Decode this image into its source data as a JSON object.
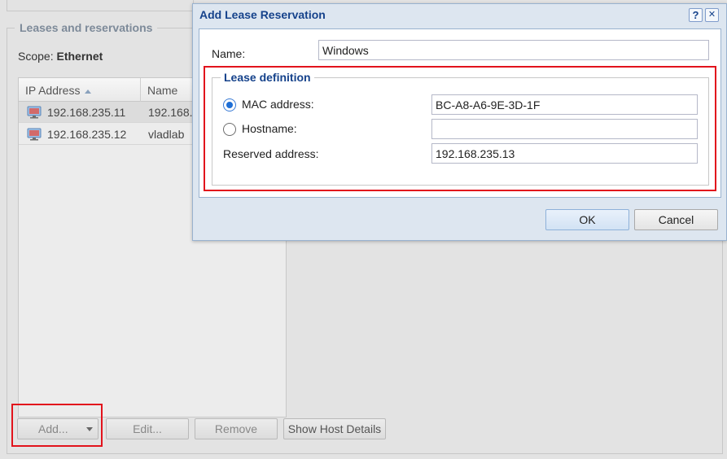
{
  "background": {
    "section_title": "Leases and reservations",
    "scope_label": "Scope:",
    "scope_value": "Ethernet",
    "grid": {
      "columns": [
        "IP Address",
        "Name"
      ],
      "rows": [
        {
          "ip": "192.168.235.11",
          "name": "192.168."
        },
        {
          "ip": "192.168.235.12",
          "name": "vladlab"
        }
      ]
    },
    "buttons": {
      "add": "Add...",
      "edit": "Edit...",
      "remove": "Remove",
      "show_host_details": "Show Host Details"
    }
  },
  "dialog": {
    "title": "Add Lease Reservation",
    "help_symbol": "?",
    "close_symbol": "✕",
    "name_label": "Name:",
    "name_value": "Windows",
    "lease_definition_title": "Lease definition",
    "mac_label": "MAC address:",
    "mac_value": "BC-A8-A6-9E-3D-1F",
    "mac_selected": true,
    "hostname_label": "Hostname:",
    "hostname_value": "",
    "reserved_label": "Reserved address:",
    "reserved_value": "192.168.235.13",
    "ok_label": "OK",
    "cancel_label": "Cancel"
  },
  "colors": {
    "highlight": "#e2131c",
    "dialog_title": "#15428b",
    "section_title": "#7d8a99"
  },
  "icons": {
    "row_icon": "monitor-icon",
    "split_button": "chevron-down-icon"
  }
}
